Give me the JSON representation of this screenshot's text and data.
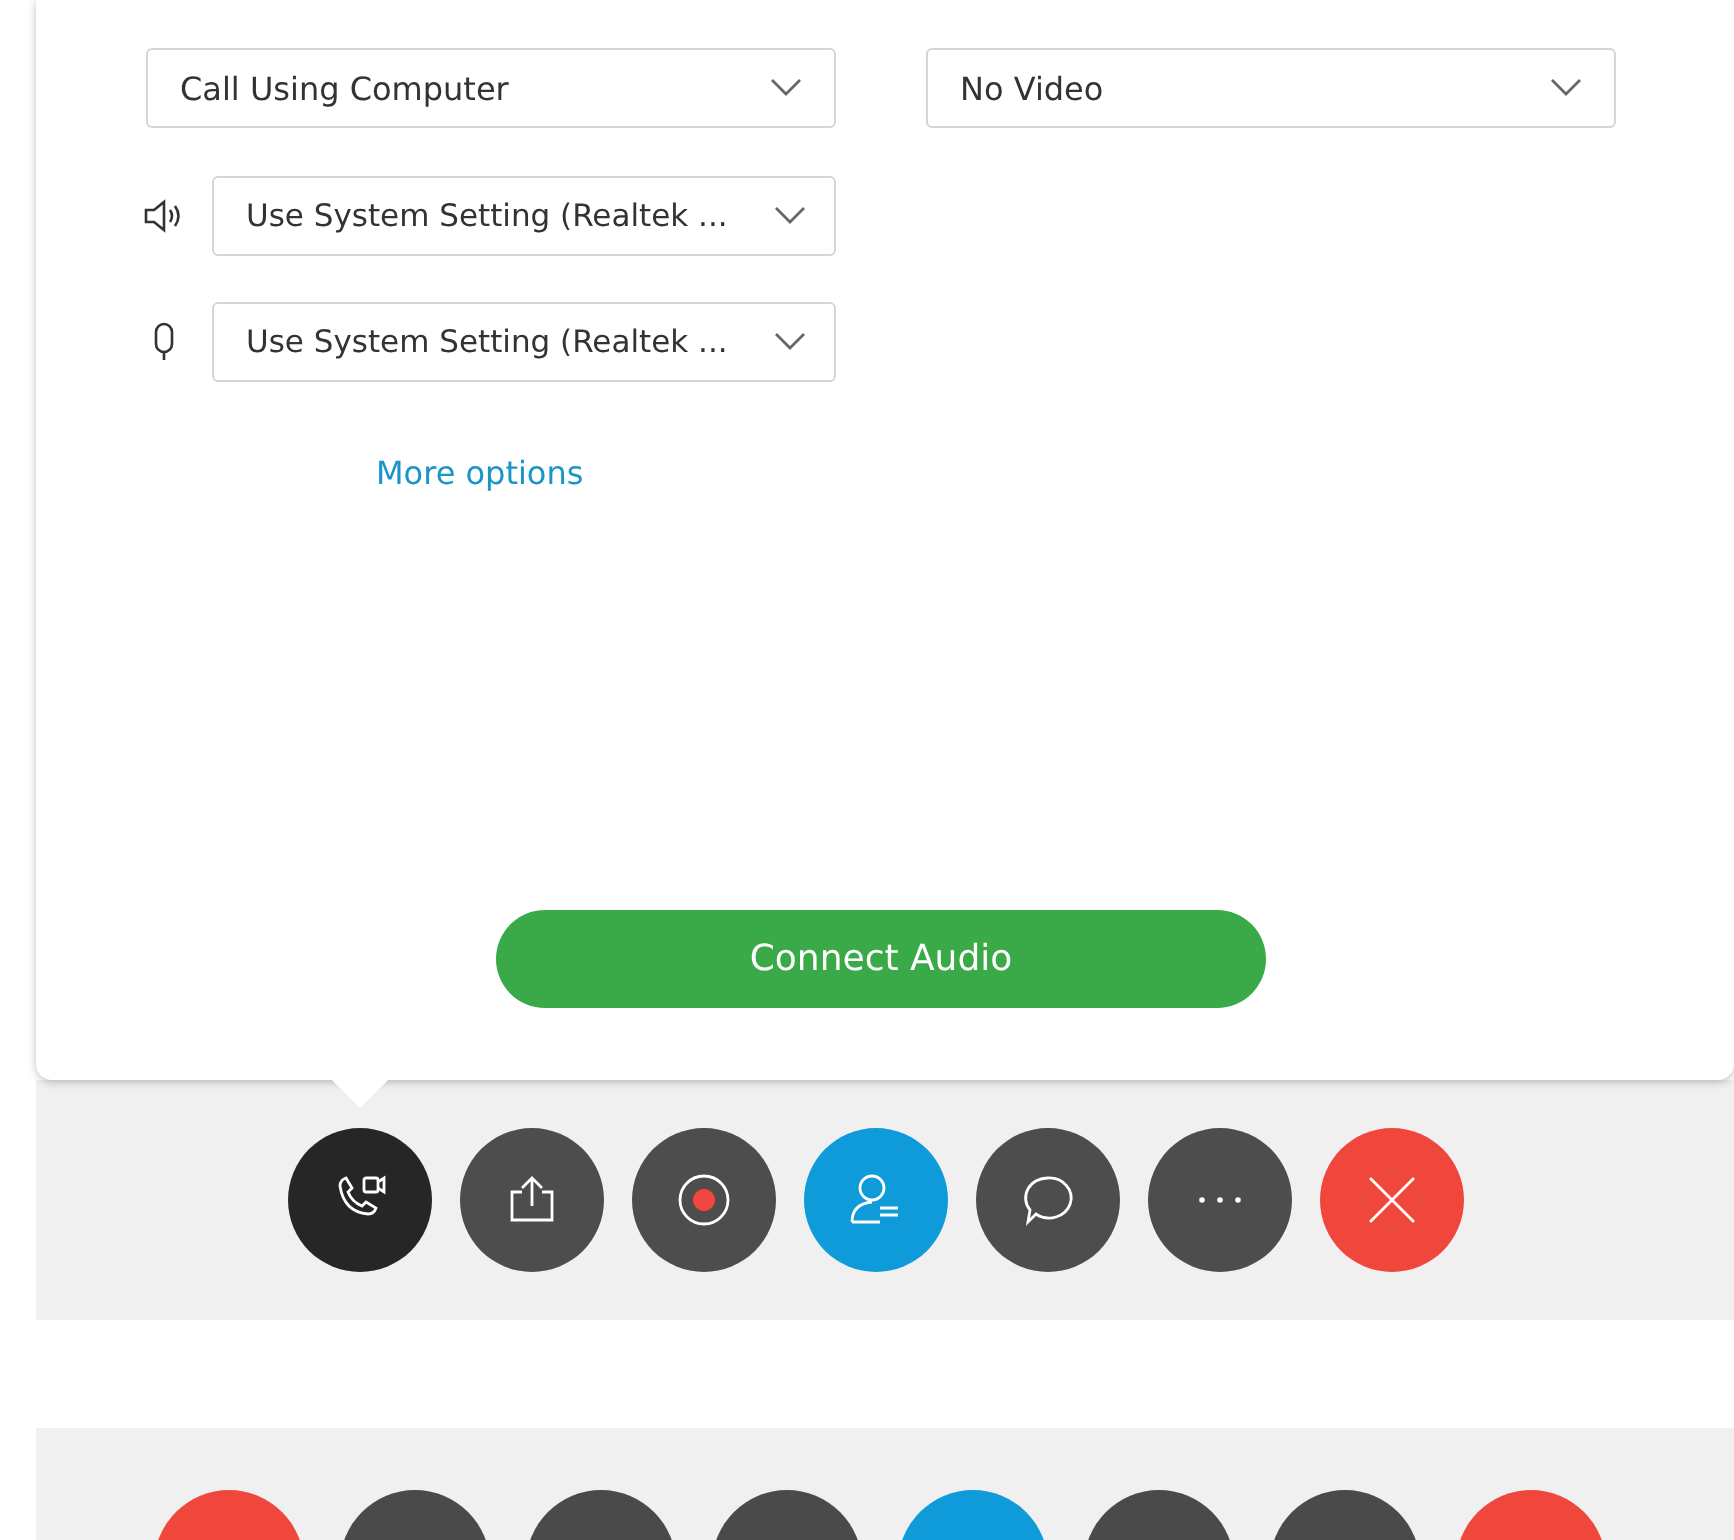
{
  "audio_panel": {
    "connection": {
      "value": "Call Using Computer"
    },
    "video": {
      "value": "No Video"
    },
    "devices": [
      {
        "kind": "speaker",
        "value": "Use System Setting (Realtek ..."
      },
      {
        "kind": "microphone",
        "value": "Use System Setting (Realtek ..."
      }
    ],
    "more_options": "More options",
    "connect_button": "Connect Audio"
  },
  "toolbar": [
    {
      "kind": "audio",
      "selected": true
    },
    {
      "kind": "share",
      "selected": false
    },
    {
      "kind": "record",
      "selected": false
    },
    {
      "kind": "participants",
      "selected": false
    },
    {
      "kind": "chat",
      "selected": false
    },
    {
      "kind": "more",
      "selected": false
    },
    {
      "kind": "end",
      "selected": false
    }
  ],
  "lower_toolbar": [
    {
      "color": "#f0473d"
    },
    {
      "color": "#4a4a4a"
    },
    {
      "color": "#4a4a4a"
    },
    {
      "color": "#4a4a4a"
    },
    {
      "color": "#0f9ad9"
    },
    {
      "color": "#4a4a4a"
    },
    {
      "color": "#4a4a4a"
    },
    {
      "color": "#f0473d"
    }
  ]
}
